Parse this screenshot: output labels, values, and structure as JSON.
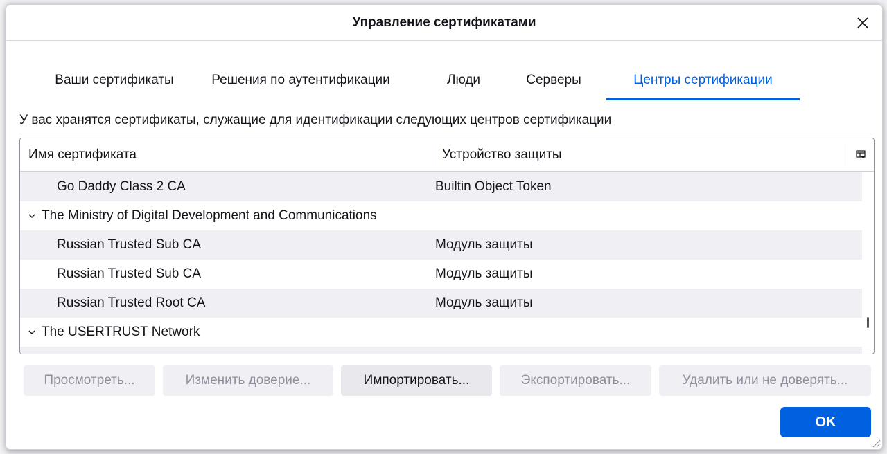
{
  "dialog": {
    "title": "Управление сертификатами"
  },
  "tabs": [
    {
      "label": "Ваши сертификаты",
      "active": false
    },
    {
      "label": "Решения по аутентификации",
      "active": false
    },
    {
      "label": "Люди",
      "active": false
    },
    {
      "label": "Серверы",
      "active": false
    },
    {
      "label": "Центры сертификации",
      "active": true
    }
  ],
  "description": "У вас хранятся сертификаты, служащие для идентификации следующих центров сертификации",
  "table": {
    "columns": [
      "Имя сертификата",
      "Устройство защиты"
    ],
    "rows": [
      {
        "type": "cert",
        "name": "Go Daddy Class 2 CA",
        "device": "Builtin Object Token"
      },
      {
        "type": "group",
        "name": "The Ministry of Digital Development and Communications"
      },
      {
        "type": "cert",
        "name": "Russian Trusted Sub CA",
        "device": "Модуль защиты"
      },
      {
        "type": "cert",
        "name": "Russian Trusted Sub CA",
        "device": "Модуль защиты"
      },
      {
        "type": "cert",
        "name": "Russian Trusted Root CA",
        "device": "Модуль защиты"
      },
      {
        "type": "group",
        "name": "The USERTRUST Network"
      }
    ]
  },
  "buttons": {
    "view": "Просмотреть...",
    "edit_trust": "Изменить доверие...",
    "import": "Импортировать...",
    "export": "Экспортировать...",
    "delete": "Удалить или не доверять...",
    "ok": "OK"
  },
  "colors": {
    "accent": "#0061e0"
  }
}
